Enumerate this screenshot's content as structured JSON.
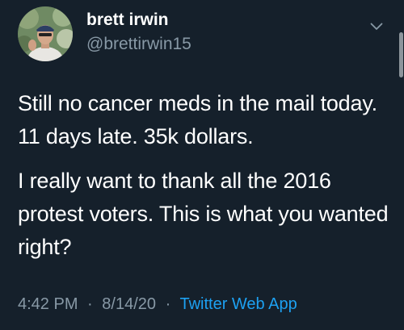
{
  "user": {
    "display_name": "brett irwin",
    "handle": "@brettirwin15"
  },
  "tweet": {
    "paragraphs": [
      "Still no cancer meds in the mail today.  11 days late.  35k dollars.",
      "I really want to thank all the 2016 protest voters.  This is what you wanted right?"
    ],
    "time": "4:42 PM",
    "separator": "·",
    "date": "8/14/20",
    "source": "Twitter Web App"
  },
  "icons": {
    "caret": "chevron-down-icon",
    "avatar": "profile-photo"
  },
  "colors": {
    "background": "#15202b",
    "text": "#ffffff",
    "secondary_text": "#8899a6",
    "link": "#1da1f2"
  }
}
